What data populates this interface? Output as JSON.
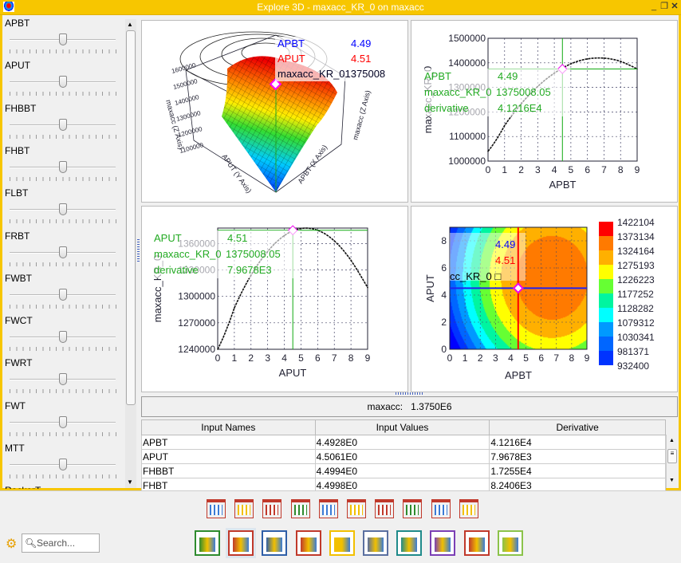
{
  "window": {
    "title": "Explore 3D - maxacc_KR_0 on maxacc",
    "controls": [
      "minimize",
      "restore",
      "close"
    ]
  },
  "sliders": [
    {
      "label": "APBT",
      "value_fraction": 0.5
    },
    {
      "label": "APUT",
      "value_fraction": 0.5
    },
    {
      "label": "FHBBT",
      "value_fraction": 0.5
    },
    {
      "label": "FHBT",
      "value_fraction": 0.5
    },
    {
      "label": "FLBT",
      "value_fraction": 0.5
    },
    {
      "label": "FRBT",
      "value_fraction": 0.5
    },
    {
      "label": "FWBT",
      "value_fraction": 0.5
    },
    {
      "label": "FWCT",
      "value_fraction": 0.5
    },
    {
      "label": "FWRT",
      "value_fraction": 0.5
    },
    {
      "label": "FWT",
      "value_fraction": 0.5
    },
    {
      "label": "MTT",
      "value_fraction": 0.5
    },
    {
      "label": "RockerT",
      "value_fraction": 0.5
    }
  ],
  "surface3d": {
    "x_axis": "APBT (X Axis)",
    "y_axis": "APUT (Y Axis)",
    "z_axis": "maxacc (Z Axis)",
    "z_ticks": [
      "1600000",
      "1500000",
      "1400000",
      "1300000",
      "1200000",
      "1100000"
    ],
    "tooltip": [
      {
        "name": "APBT",
        "value": "4.49",
        "color": "#0000ff"
      },
      {
        "name": "APUT",
        "value": "4.51",
        "color": "#ff0000"
      },
      {
        "name": "maxacc_KR_0",
        "value": "1375008",
        "color": "#000040"
      }
    ]
  },
  "chart_data": [
    {
      "type": "line",
      "xlabel": "APBT",
      "ylabel": "maxacc_KR_0",
      "xlim": [
        0,
        9
      ],
      "ylim": [
        1000000,
        1500000
      ],
      "xticks": [
        "0",
        "1",
        "2",
        "3",
        "4",
        "5",
        "6",
        "7",
        "8",
        "9"
      ],
      "yticks": [
        "1000000",
        "1100000",
        "1200000",
        "1300000",
        "1400000",
        "1500000"
      ],
      "x": [
        0,
        1,
        2,
        3,
        4,
        5,
        6,
        7,
        8,
        9
      ],
      "y": [
        1040000,
        1145000,
        1233000,
        1304000,
        1358000,
        1396000,
        1416000,
        1419000,
        1406000,
        1375000
      ],
      "cursor": {
        "x": 4.49,
        "y": 1375008.05
      },
      "grid": true,
      "tooltip": [
        {
          "name": "APBT",
          "value": "4.49"
        },
        {
          "name": "maxacc_KR_0",
          "value": "1375008.05"
        },
        {
          "name": "derivative",
          "value": "4.1216E4"
        }
      ]
    },
    {
      "type": "line",
      "xlabel": "APUT",
      "ylabel": "maxacc_KR_0",
      "xlim": [
        0,
        9
      ],
      "ylim": [
        1240000,
        1377500
      ],
      "xticks": [
        "0",
        "1",
        "2",
        "3",
        "4",
        "5",
        "6",
        "7",
        "8",
        "9"
      ],
      "yticks": [
        "1240000",
        "1270000",
        "1300000",
        "1330000",
        "1360000"
      ],
      "x": [
        0,
        1,
        2,
        3,
        4,
        5,
        6,
        7,
        8,
        9
      ],
      "y": [
        1240000,
        1287000,
        1324000,
        1351000,
        1369000,
        1377000,
        1375000,
        1363000,
        1341000,
        1310000
      ],
      "cursor": {
        "x": 4.51,
        "y": 1375008.05
      },
      "grid": true,
      "tooltip": [
        {
          "name": "APUT",
          "value": "4.51"
        },
        {
          "name": "maxacc_KR_0",
          "value": "1375008.05"
        },
        {
          "name": "derivative",
          "value": "7.9678E3"
        }
      ]
    },
    {
      "type": "heatmap",
      "xlabel": "APBT",
      "ylabel": "APUT",
      "xlim": [
        0,
        9
      ],
      "ylim": [
        0,
        9
      ],
      "xticks": [
        "0",
        "1",
        "2",
        "3",
        "4",
        "5",
        "6",
        "7",
        "8",
        "9"
      ],
      "yticks": [
        "0",
        "2",
        "4",
        "6",
        "8"
      ],
      "levels": [
        "1422104",
        "1373134",
        "1324164",
        "1275193",
        "1226223",
        "1177252",
        "1128282",
        "1079312",
        "1030341",
        "981371",
        "932400"
      ],
      "level_colors": [
        "#ff0000",
        "#ff7a00",
        "#ffb000",
        "#ffff00",
        "#66ff33",
        "#00f5a0",
        "#00ffff",
        "#0099ff",
        "#0066ff",
        "#0033ff",
        "#0000ff"
      ],
      "cursor": {
        "x": 4.49,
        "y": 4.51
      },
      "tooltip": [
        {
          "value": "4.49",
          "color": "#0000ff"
        },
        {
          "value": "4.51",
          "color": "#ff0000"
        },
        {
          "value": "cc_KR_0 □",
          "color": "#000"
        }
      ]
    }
  ],
  "info": {
    "label": "maxacc:",
    "value": "1.3750E6"
  },
  "table": {
    "headers": [
      "Input Names",
      "Input Values",
      "Derivative"
    ],
    "rows": [
      [
        "APBT",
        "4.4928E0",
        "4.1216E4"
      ],
      [
        "APUT",
        "4.5061E0",
        "7.9678E3"
      ],
      [
        "FHBBT",
        "4.4994E0",
        "1.7255E4"
      ],
      [
        "FHBT",
        "4.4998E0",
        "8.2406E3"
      ]
    ]
  },
  "toolbar": {
    "search_placeholder": "Search...",
    "top_icons": [
      "heatmap-table-icon",
      "scatter-matrix-icon",
      "boxplot-icon",
      "boxplot-grid-icon",
      "parallel-lines-icon",
      "boxplot-pair-icon",
      "network-plot-icon",
      "bar-chart-icon",
      "pie-grid-icon",
      "bar-3d-icon"
    ],
    "bottom_icons": [
      {
        "name": "parallel-coordinates-icon",
        "color": "#2e8b2e"
      },
      {
        "name": "stacked-bar-icon",
        "color": "#c0392b",
        "selected": true
      },
      {
        "name": "distribution-icon",
        "color": "#2f5fa8"
      },
      {
        "name": "funnel-filter-icon",
        "color": "#c0392b"
      },
      {
        "name": "area-spectrum-icon",
        "color": "#f2c000"
      },
      {
        "name": "bar-icon",
        "color": "#5a6fa0"
      },
      {
        "name": "bubble-cluster-icon",
        "color": "#1f8a8a"
      },
      {
        "name": "surface-icon",
        "color": "#7b3fb5"
      },
      {
        "name": "merge-arrows-icon",
        "color": "#c0392b"
      },
      {
        "name": "scatter-tree-icon",
        "color": "#8bc34a"
      }
    ]
  }
}
